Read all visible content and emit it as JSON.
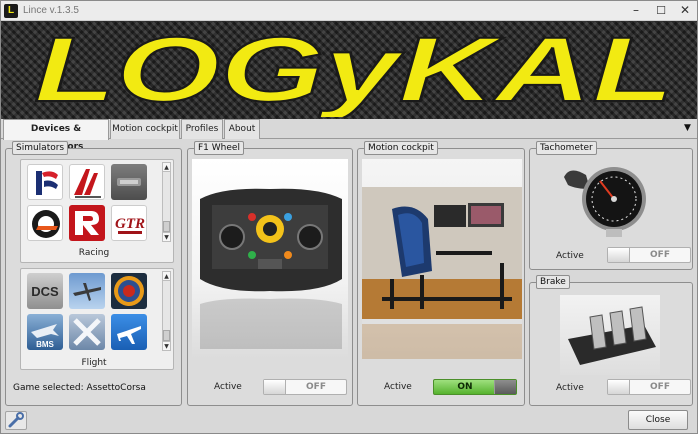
{
  "window": {
    "app_icon_letter": "L",
    "title": "Lince v.1.3.5",
    "minimize_glyph": "–",
    "maximize_glyph": "☐",
    "close_glyph": "✕"
  },
  "banner": {
    "logo_text": "LOGyKAL",
    "logo_color": "#f2ea12"
  },
  "tabs": [
    {
      "label": "Devices & Simulators",
      "active": true
    },
    {
      "label": "Motion cockpit",
      "active": false
    },
    {
      "label": "Profiles",
      "active": false
    },
    {
      "label": "About",
      "active": false
    }
  ],
  "tab_menu_glyph": "▼",
  "simulators": {
    "title": "Simulators",
    "racing": {
      "caption": "Racing",
      "icons": [
        "iracing-icon",
        "assetto-corsa-icon",
        "generic-sim-icon",
        "rfactor2-icon",
        "raceroom-icon",
        "gtr-icon"
      ]
    },
    "flight": {
      "caption": "Flight",
      "icons": [
        "dcs-icon",
        "il2-icon",
        "raf-roundel-icon",
        "falcon-bms-icon",
        "xplane-icon",
        "fsx-icon"
      ]
    },
    "scroll_up": "▲",
    "scroll_down": "▼",
    "game_selected": "Game selected: AssettoCorsa"
  },
  "devices": [
    {
      "id": "f1",
      "title": "F1 Wheel",
      "active_label": "Active",
      "state": "OFF"
    },
    {
      "id": "motion",
      "title": "Motion cockpit",
      "active_label": "Active",
      "state": "ON"
    },
    {
      "id": "tacho",
      "title": "Tachometer",
      "active_label": "Active",
      "state": "OFF"
    },
    {
      "id": "brake",
      "title": "Brake",
      "active_label": "Active",
      "state": "OFF"
    }
  ],
  "footer": {
    "close_label": "Close"
  },
  "colors": {
    "on_green": "#56b22e",
    "off_text": "#8a8a8a",
    "panel_bg": "#dcdcdc"
  }
}
